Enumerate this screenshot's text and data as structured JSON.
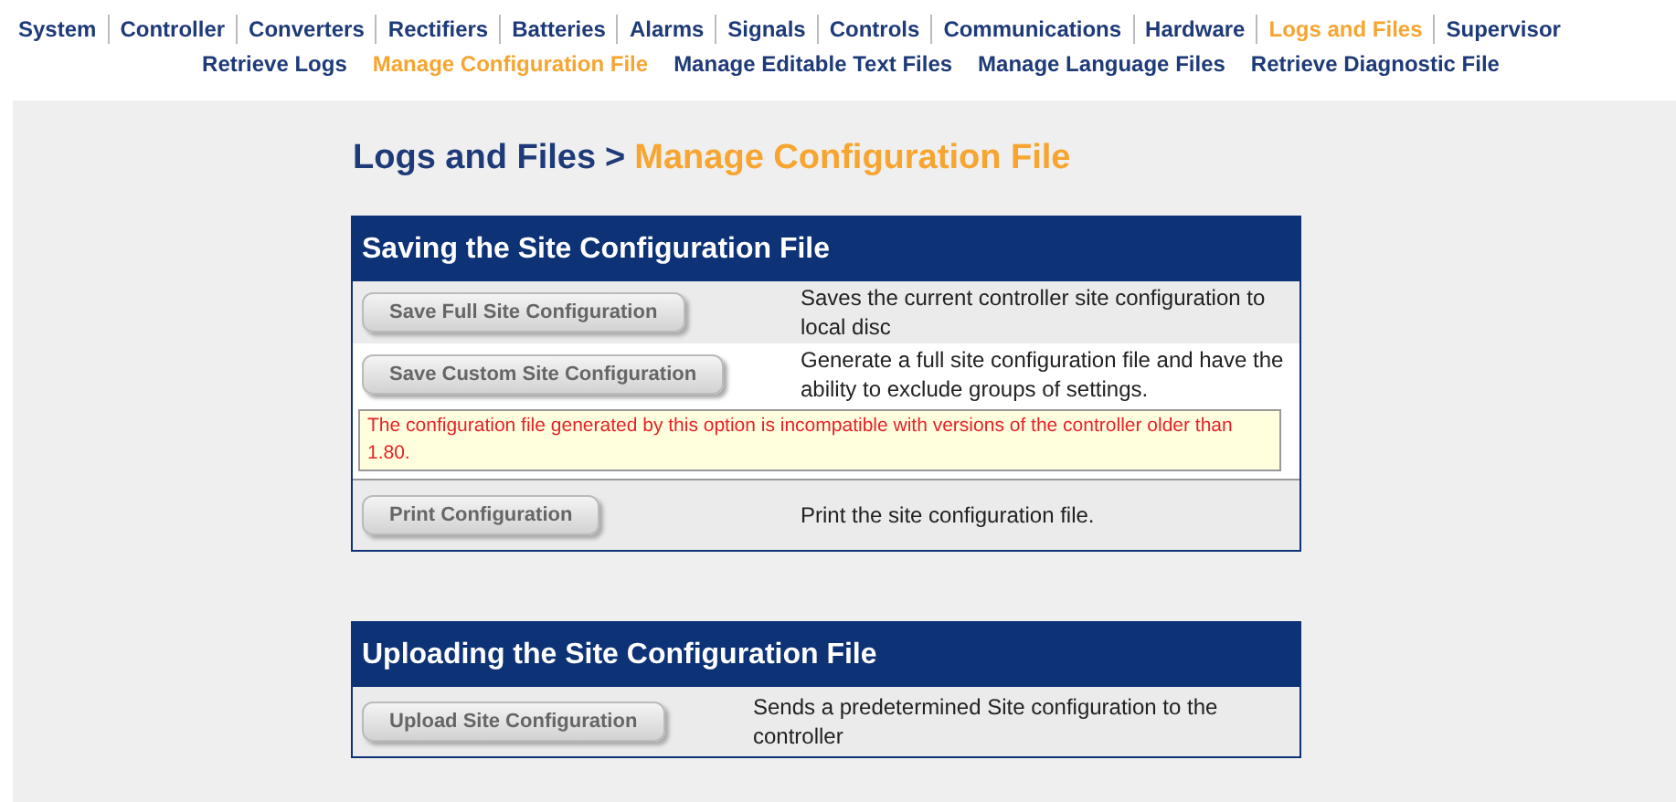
{
  "main_nav": [
    {
      "label": "System",
      "selected": false
    },
    {
      "label": "Controller",
      "selected": false
    },
    {
      "label": "Converters",
      "selected": false
    },
    {
      "label": "Rectifiers",
      "selected": false
    },
    {
      "label": "Batteries",
      "selected": false
    },
    {
      "label": "Alarms",
      "selected": false
    },
    {
      "label": "Signals",
      "selected": false
    },
    {
      "label": "Controls",
      "selected": false
    },
    {
      "label": "Communications",
      "selected": false
    },
    {
      "label": "Hardware",
      "selected": false
    },
    {
      "label": "Logs and Files",
      "selected": true
    },
    {
      "label": "Supervisor",
      "selected": false
    }
  ],
  "sub_nav": [
    {
      "label": "Retrieve Logs",
      "selected": false
    },
    {
      "label": "Manage Configuration File",
      "selected": true
    },
    {
      "label": "Manage Editable Text Files",
      "selected": false
    },
    {
      "label": "Manage Language Files",
      "selected": false
    },
    {
      "label": "Retrieve Diagnostic File",
      "selected": false
    }
  ],
  "breadcrumb": {
    "parent": "Logs and Files",
    "separator": ">",
    "current": "Manage Configuration File"
  },
  "sections": [
    {
      "title": "Saving the Site Configuration File",
      "rows": [
        {
          "kind": "action",
          "shaded": true,
          "button": "Save Full Site Configuration",
          "description": "Saves the current controller site configuration to local disc"
        },
        {
          "kind": "action",
          "shaded": false,
          "button": "Save Custom Site Configuration",
          "description": "Generate a full site configuration file and have the ability to exclude groups of settings."
        },
        {
          "kind": "note",
          "shaded": false,
          "text": "The configuration file generated by this option is incompatible with versions of the controller older than 1.80."
        },
        {
          "kind": "action",
          "shaded": true,
          "button": "Print Configuration",
          "description": "Print the site configuration file."
        }
      ]
    },
    {
      "title": "Uploading the Site Configuration File",
      "rows": [
        {
          "kind": "action",
          "shaded": true,
          "button": "Upload Site Configuration",
          "description": "Sends a predetermined Site configuration to the controller"
        }
      ]
    }
  ]
}
